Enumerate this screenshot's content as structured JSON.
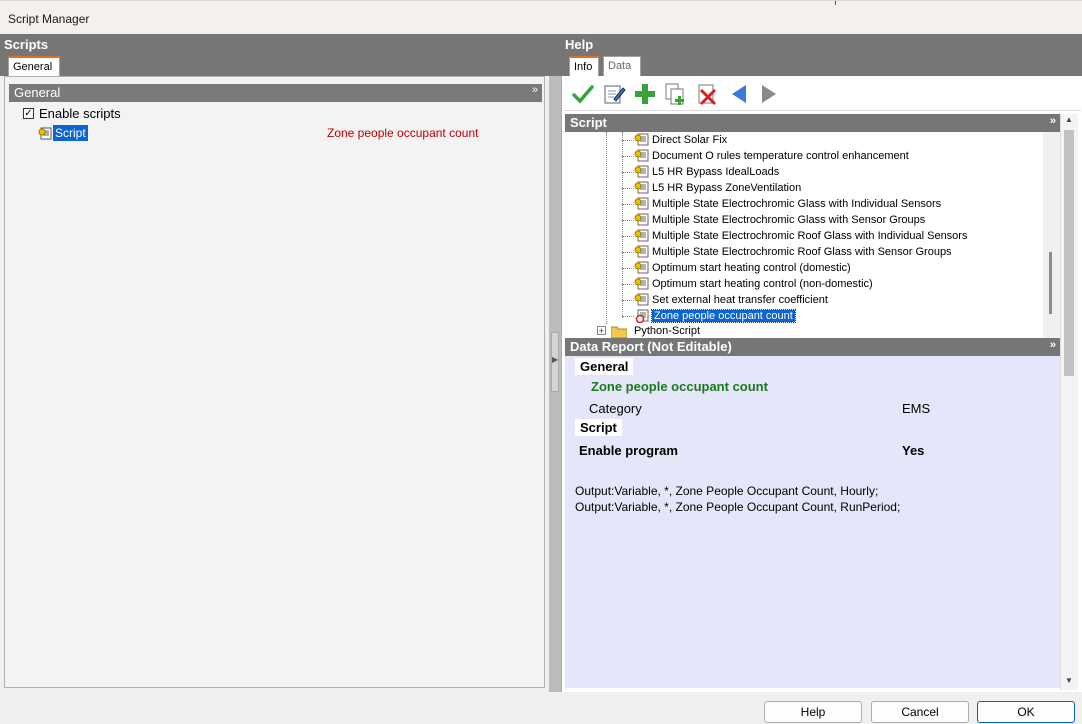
{
  "window": {
    "title": "Script Manager"
  },
  "left": {
    "panel_title": "Scripts",
    "tab": "General",
    "section": "General",
    "enable_scripts": {
      "label": "Enable scripts",
      "checked": true
    },
    "script": {
      "label": "Script",
      "value": "Zone people occupant count"
    }
  },
  "right": {
    "panel_title": "Help",
    "tabs": [
      "Info",
      "Data"
    ],
    "toolbar": [
      "check-icon",
      "edit-icon",
      "add-icon",
      "copy-icon",
      "delete-icon",
      "back-icon",
      "forward-icon"
    ],
    "script_header": "Script",
    "tree_items": [
      "Direct Solar Fix",
      "Document O rules temperature control enhancement",
      "L5 HR Bypass IdealLoads",
      "L5 HR Bypass ZoneVentilation",
      "Multiple State Electrochromic Glass with Individual Sensors",
      "Multiple State Electrochromic Glass with Sensor Groups",
      "Multiple State Electrochromic Roof Glass with Individual Sensors",
      "Multiple State Electrochromic Roof Glass with Sensor Groups",
      "Optimum start heating control (domestic)",
      "Optimum start heating control (non-domestic)",
      "Set external heat transfer coefficient",
      "Zone people occupant count"
    ],
    "tree_folder": "Python-Script",
    "report": {
      "header": "Data Report (Not Editable)",
      "general_label": "General",
      "name": "Zone people occupant count",
      "category_label": "Category",
      "category_value": "EMS",
      "script_label": "Script",
      "enable_label": "Enable program",
      "enable_value": "Yes",
      "output_lines": [
        "Output:Variable, *, Zone People Occupant Count, Hourly;",
        "Output:Variable, *, Zone People Occupant Count, RunPeriod;"
      ]
    }
  },
  "buttons": {
    "help": "Help",
    "cancel": "Cancel",
    "ok": "OK"
  },
  "colors": {
    "accent": "#e07020",
    "selection": "#0a64d2",
    "report_bg": "#e6e6fa",
    "name_green": "#1a7a1a",
    "value_red": "#c00000"
  }
}
